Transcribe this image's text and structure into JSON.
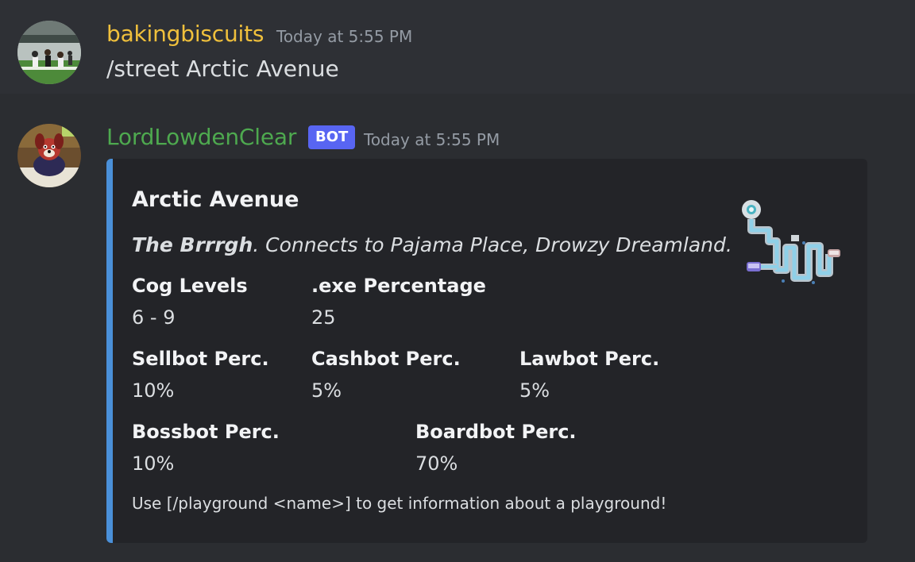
{
  "messages": [
    {
      "username": "bakingbiscuits",
      "timestamp": "Today at 5:55 PM",
      "text": "/street Arctic Avenue"
    },
    {
      "username": "LordLowdenClear",
      "badge": "BOT",
      "timestamp": "Today at 5:55 PM",
      "embed": {
        "title": "Arctic Avenue",
        "desc_bold": "The Brrrgh",
        "desc_rest": ". Connects to Pajama Place, Drowzy Dreamland.",
        "fields": {
          "cog_levels": {
            "name": "Cog Levels",
            "value": "6 - 9"
          },
          "exe_percentage": {
            "name": ".exe Percentage",
            "value": "25"
          },
          "sellbot": {
            "name": "Sellbot Perc.",
            "value": "10%"
          },
          "cashbot": {
            "name": "Cashbot Perc.",
            "value": "5%"
          },
          "lawbot": {
            "name": "Lawbot Perc.",
            "value": "5%"
          },
          "bossbot": {
            "name": "Bossbot Perc.",
            "value": "10%"
          },
          "boardbot": {
            "name": "Boardbot Perc.",
            "value": "70%"
          }
        },
        "footer": "Use [/playground <name>] to get information about a playground!",
        "accent_color": "#4a90d9"
      }
    }
  ],
  "colors": {
    "background": "#2b2d31",
    "username1": "#f0c03c",
    "username2": "#4ea94f",
    "badge": "#5865f2"
  }
}
